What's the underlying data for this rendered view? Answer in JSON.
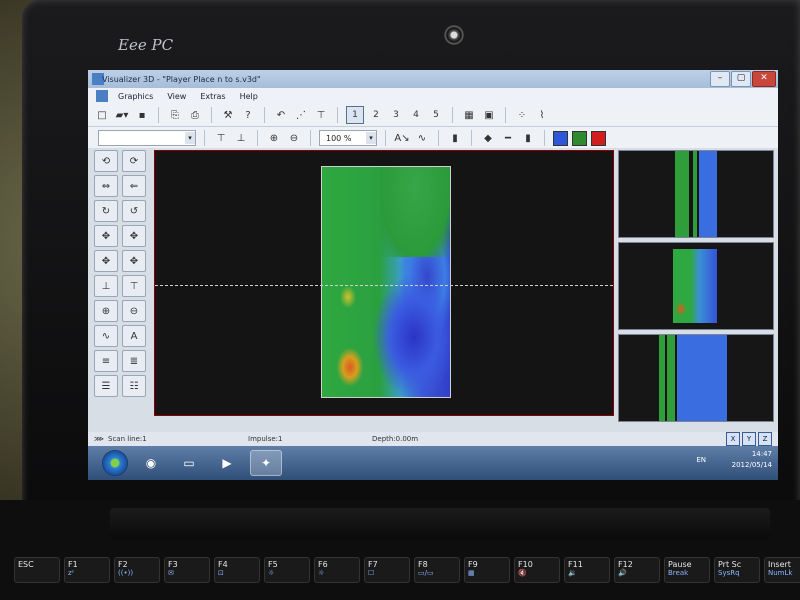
{
  "window": {
    "title": "Visualizer 3D - \"Player Place n to s.v3d\"",
    "controls": [
      "–",
      "▢",
      "✕"
    ]
  },
  "menu": [
    "Graphics",
    "View",
    "Extras",
    "Help"
  ],
  "toolbar1": {
    "view_numbers": [
      "1",
      "2",
      "3",
      "4",
      "5"
    ],
    "active_view": "1"
  },
  "toolbar2": {
    "zoom_value": "100 %",
    "palette_colors": [
      "#2f56d8",
      "#2e8a2e",
      "#d11d1d"
    ]
  },
  "status": {
    "scan_line": "Scan line:1",
    "impulse": "Impulse:1",
    "depth": "Depth:0.00m",
    "axis_buttons": [
      "X",
      "Y",
      "Z"
    ]
  },
  "taskbar": {
    "language": "EN",
    "time": "14:47",
    "date": "2012/05/14"
  },
  "laptop": {
    "brand": "Eee PC"
  },
  "keyboard": {
    "fkeys": [
      {
        "label": "ESC",
        "sub": ""
      },
      {
        "label": "F1",
        "sub": "zᶻ"
      },
      {
        "label": "F2",
        "sub": "((•))"
      },
      {
        "label": "F3",
        "sub": "✉"
      },
      {
        "label": "F4",
        "sub": "⊡"
      },
      {
        "label": "F5",
        "sub": "☼"
      },
      {
        "label": "F6",
        "sub": "☼"
      },
      {
        "label": "F7",
        "sub": "☐"
      },
      {
        "label": "F8",
        "sub": "▭/▭"
      },
      {
        "label": "F9",
        "sub": "▦"
      },
      {
        "label": "F10",
        "sub": "🔇"
      },
      {
        "label": "F11",
        "sub": "🔉"
      },
      {
        "label": "F12",
        "sub": "🔊"
      },
      {
        "label": "Pause",
        "sub": "Break"
      },
      {
        "label": "Prt Sc",
        "sub": "SysRq"
      },
      {
        "label": "Insert",
        "sub": "NumLk"
      }
    ]
  }
}
